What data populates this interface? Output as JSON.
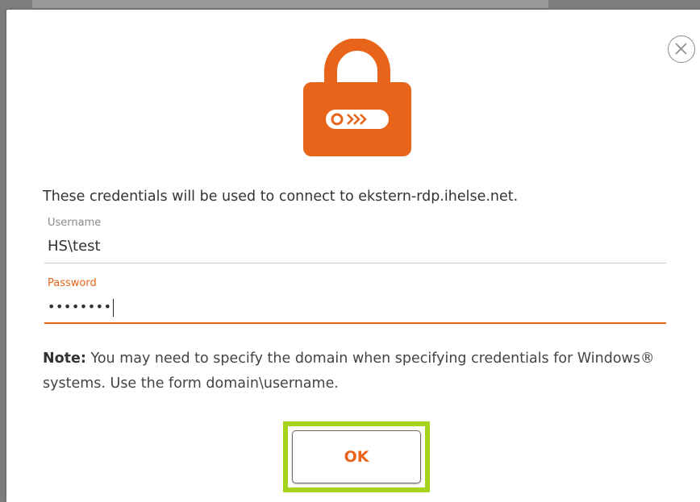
{
  "dialog": {
    "message": "These credentials will be used to connect to ekstern-rdp.ihelse.net.",
    "username": {
      "label": "Username",
      "value": "HS\\test"
    },
    "password": {
      "label": "Password",
      "masked_value": "••••••••"
    },
    "note": {
      "prefix": "Note:",
      "text": " You may need to specify the domain when specifying credentials for Windows® systems. Use the form domain\\username."
    },
    "ok_label": "OK",
    "icons": {
      "lock": "lock-icon",
      "close": "close-icon"
    }
  },
  "colors": {
    "accent": "#e8641b",
    "highlight": "#a4d41c",
    "text": "#333333"
  }
}
